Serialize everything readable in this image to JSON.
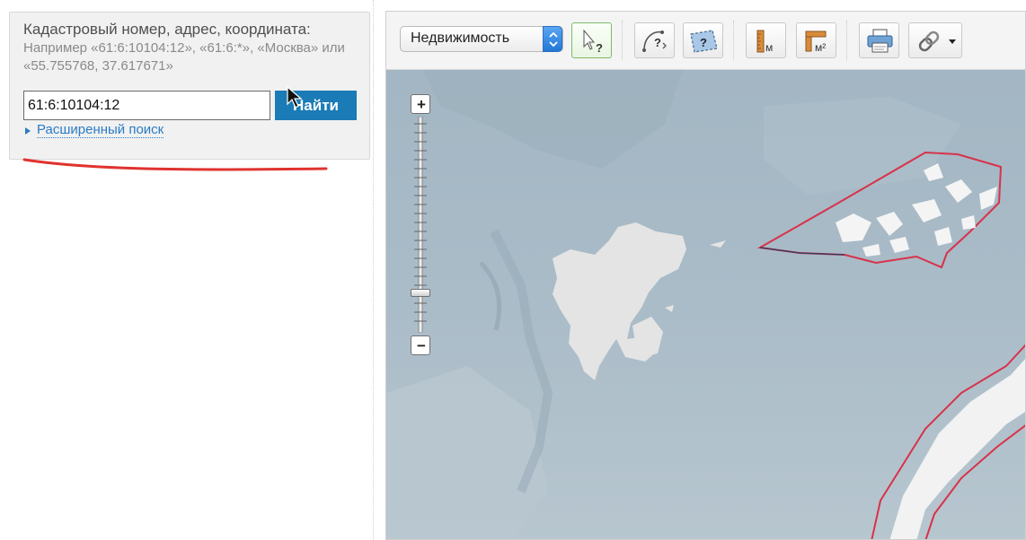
{
  "search": {
    "title": "Кадастровый номер, адрес, координата:",
    "hint": "Например «61:6:10104:12», «61:6:*», «Москва» или «55.755768, 37.617671»",
    "input_value": "61:6:10104:12",
    "find_button": "Найти",
    "advanced_link": "Расширенный поиск"
  },
  "toolbar": {
    "layer_select": "Недвижимость",
    "buttons": [
      {
        "name": "identify",
        "icon": "cursor-question-icon",
        "active": true
      },
      {
        "name": "identify-polygon",
        "icon": "curve-question-icon"
      },
      {
        "name": "identify-area",
        "icon": "map-question-icon"
      },
      {
        "name": "measure-length",
        "icon": "ruler-icon",
        "unit": "м"
      },
      {
        "name": "measure-area",
        "icon": "area-ruler-icon",
        "unit": "м²"
      },
      {
        "name": "print",
        "icon": "printer-icon"
      },
      {
        "name": "link",
        "icon": "chain-link-icon"
      }
    ]
  },
  "map": {
    "zoom_in": "+",
    "zoom_out": "−",
    "zoom_level": 0.8,
    "colors": {
      "water": "#a7bac6",
      "land": "#e4e4e4",
      "boundary": "#d8324a",
      "search_button": "#1a7bb6",
      "link": "#2a7cc4"
    }
  }
}
